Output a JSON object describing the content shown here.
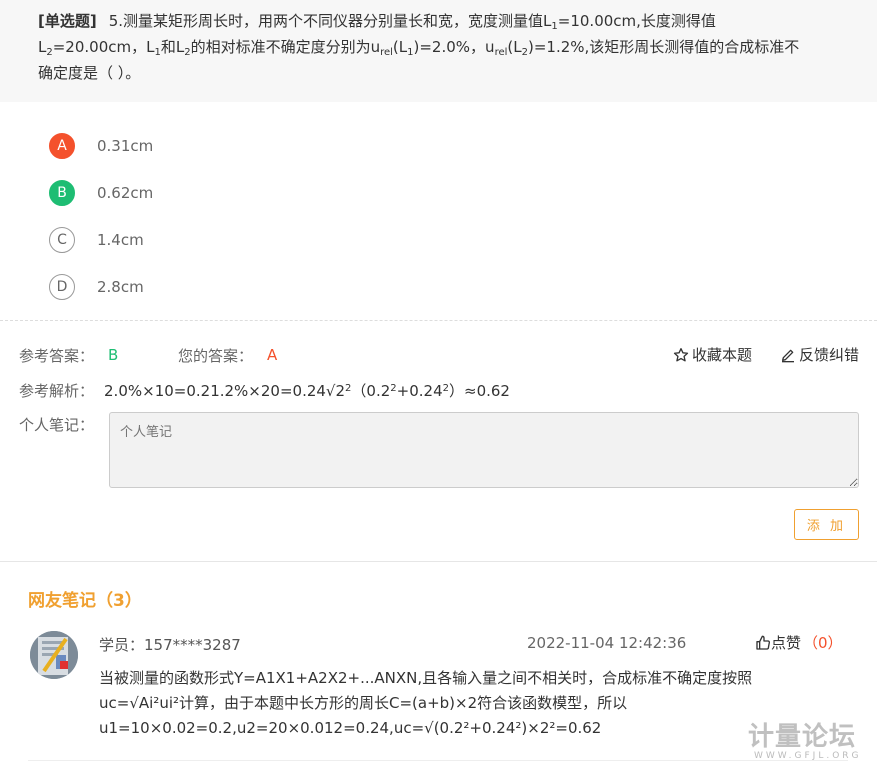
{
  "question": {
    "type_label": "[单选题]",
    "p1": "5.测量某矩形周长时，用两个不同仪器分别量长和宽，宽度测量值L",
    "s1": "1",
    "p2": "=10.00cm,长度测得值",
    "p3": "L",
    "s2": "2",
    "p4": "=20.00cm，L",
    "s3": "1",
    "p5": "和L",
    "s4": "2",
    "p6": "的相对标准不确定度分别为u",
    "s5": "rel",
    "p7": "(L",
    "s6": "1",
    "p8": ")=2.0%，u",
    "s7": "rel",
    "p9": "(L",
    "s8": "2",
    "p10": ")=1.2%,该矩形周长测得值的合成标准不",
    "p11": "确定度是（      ）。"
  },
  "options": [
    {
      "letter": "A",
      "text": "0.31cm"
    },
    {
      "letter": "B",
      "text": "0.62cm"
    },
    {
      "letter": "C",
      "text": "1.4cm"
    },
    {
      "letter": "D",
      "text": "2.8cm"
    }
  ],
  "answer": {
    "ref_label": "参考答案：",
    "ref_value": "B",
    "your_label": "您的答案：",
    "your_value": "A",
    "collect_label": "收藏本题",
    "feedback_label": "反馈纠错"
  },
  "analysis": {
    "label": "参考解析：",
    "t1": "2.0%×10=0.21.2%×20=0.24√2",
    "sup1": "2",
    "t2": "（0.2",
    "sup2": "2",
    "t3": "+0.24",
    "sup3": "2",
    "t4": "）≈0.62"
  },
  "note": {
    "label": "个人笔记：",
    "placeholder": "个人笔记",
    "add_label": "添 加"
  },
  "comments": {
    "title": "网友笔记（3）",
    "items": [
      {
        "user": "学员：157****3287",
        "time": "2022-11-04 12:42:36",
        "like_label": "点赞",
        "like_count": "（0）",
        "line1": "当被测量的函数形式Y=A1X1+A2X2+...ANXN,且各输入量之间不相关时，合成标准不确定度按照",
        "line2": "uc=√Ai²ui²计算，由于本题中长方形的周长C=(a+b)×2符合该函数模型，所以",
        "line3": "u1=10×0.02=0.2,u2=20×0.012=0.24,uc=√(0.2²+0.24²)×2²=0.62"
      }
    ]
  },
  "watermark": {
    "main": "计量论坛",
    "sub": "WWW.GFJL.ORG"
  }
}
